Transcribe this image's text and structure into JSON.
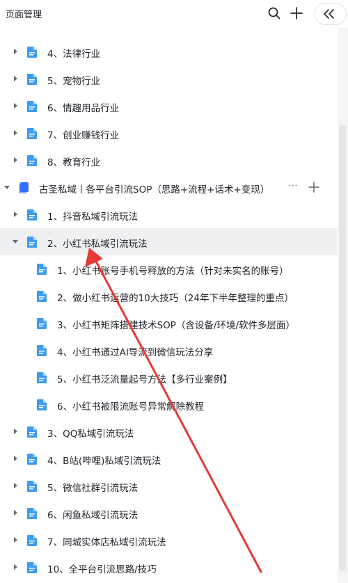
{
  "header": {
    "title": "页面管理"
  },
  "colors": {
    "doc_icon": "#3c9cf0",
    "folder_icon": "#3370ff",
    "arrow": "#e53935",
    "selected_bg": "#eff0f1"
  },
  "tree": [
    {
      "label": "4、法律行业",
      "level": 0,
      "caret": "right",
      "icon": "doc"
    },
    {
      "label": "5、宠物行业",
      "level": 0,
      "caret": "right",
      "icon": "doc"
    },
    {
      "label": "6、情趣用品行业",
      "level": 0,
      "caret": "right",
      "icon": "doc"
    },
    {
      "label": "7、创业赚钱行业",
      "level": 0,
      "caret": "right",
      "icon": "doc"
    },
    {
      "label": "8、教育行业",
      "level": 0,
      "caret": "right",
      "icon": "doc"
    },
    {
      "label": "古圣私域丨各平台引流SOP（思路+流程+话术+变现）",
      "level": -1,
      "caret": "down",
      "icon": "folder",
      "actions": true
    },
    {
      "label": "1、抖音私域引流玩法",
      "level": 0,
      "caret": "right",
      "icon": "doc"
    },
    {
      "label": "2、小红书私域引流玩法",
      "level": 0,
      "caret": "down",
      "icon": "doc",
      "selected": true
    },
    {
      "label": "1、小红书账号手机号释放的方法（针对未实名的账号）",
      "level": 1,
      "caret": "none",
      "icon": "doc"
    },
    {
      "label": "2、做小红书运营的10大技巧（24年下半年整理的重点）",
      "level": 1,
      "caret": "none",
      "icon": "doc"
    },
    {
      "label": "3、小红书矩阵搭建技术SOP（含设备/环境/软件多层面）",
      "level": 1,
      "caret": "none",
      "icon": "doc"
    },
    {
      "label": "4、小红书通过AI导流到微信玩法分享",
      "level": 1,
      "caret": "none",
      "icon": "doc"
    },
    {
      "label": "5、小红书泛流量起号方法【多行业案例】",
      "level": 1,
      "caret": "none",
      "icon": "doc"
    },
    {
      "label": "6、小红书被限流账号异常解除教程",
      "level": 1,
      "caret": "none",
      "icon": "doc"
    },
    {
      "label": "3、QQ私域引流玩法",
      "level": 0,
      "caret": "right",
      "icon": "doc"
    },
    {
      "label": "4、B站(哔哩)私域引流玩法",
      "level": 0,
      "caret": "right",
      "icon": "doc"
    },
    {
      "label": "5、微信社群引流玩法",
      "level": 0,
      "caret": "right",
      "icon": "doc"
    },
    {
      "label": "6、闲鱼私域引流玩法",
      "level": 0,
      "caret": "right",
      "icon": "doc"
    },
    {
      "label": "7、同城实体店私域引流玩法",
      "level": 0,
      "caret": "right",
      "icon": "doc"
    },
    {
      "label": "10、全平台引流思路/技巧",
      "level": 0,
      "caret": "right",
      "icon": "doc"
    }
  ]
}
